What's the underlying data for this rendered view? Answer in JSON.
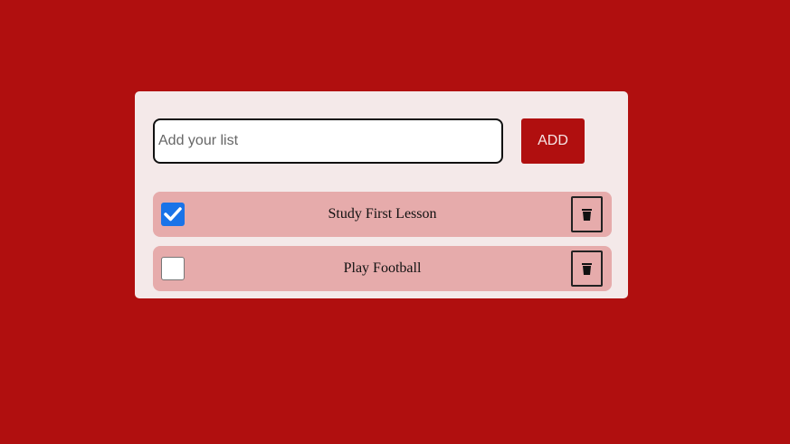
{
  "form": {
    "input_value": "",
    "input_placeholder": "Add your list",
    "add_label": "ADD"
  },
  "todos": [
    {
      "label": "Study First Lesson",
      "checked": true
    },
    {
      "label": "Play Football",
      "checked": false
    }
  ],
  "icons": {
    "check": "checkmark-icon",
    "delete": "trash-icon"
  },
  "colors": {
    "background": "#b00f0f",
    "card": "#f4e9e9",
    "item": "#e6abab",
    "checkbox_checked": "#1a73e8"
  }
}
